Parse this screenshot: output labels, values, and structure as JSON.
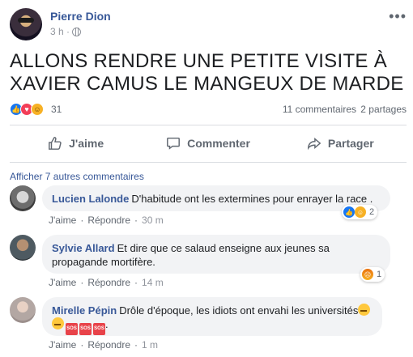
{
  "post": {
    "author": "Pierre Dion",
    "time": "3 h ·",
    "text": "ALLONS RENDRE UNE PETITE VISITE À XAVIER CAMUS LE MANGEUX DE MARDE",
    "reaction_count": "31",
    "comments_count": "11 commentaires",
    "shares_count": "2 partages"
  },
  "actions": {
    "like": "J'aime",
    "comment": "Commenter",
    "share": "Partager"
  },
  "comments_section": {
    "view_more": "Afficher 7 autres commentaires",
    "items": [
      {
        "name": "Lucien Lalonde",
        "text": "D'habitude ont les extermines pour enrayer la race .",
        "like": "J'aime",
        "reply": "Répondre",
        "time": "30 m",
        "reactions": "2"
      },
      {
        "name": "Sylvie Allard",
        "text": "Et dire que ce salaud enseigne aux jeunes sa propagande mortifère.",
        "like": "J'aime",
        "reply": "Répondre",
        "time": "14 m",
        "reactions": "1"
      },
      {
        "name": "Mirelle Pépin",
        "text": "Drôle d'époque, les idiots ont envahi les universités",
        "text_end": ".",
        "sos": "SOS",
        "like": "J'aime",
        "reply": "Répondre",
        "time": "1 m"
      }
    ]
  },
  "colors": {
    "link": "#385898",
    "like_blue": "#1877f2",
    "love_red": "#f33e58",
    "haha_yellow": "#f7b125",
    "bubble_bg": "#f2f3f5"
  },
  "icons": [
    "more-icon",
    "globe-icon",
    "like-icon",
    "comment-icon",
    "share-icon"
  ]
}
